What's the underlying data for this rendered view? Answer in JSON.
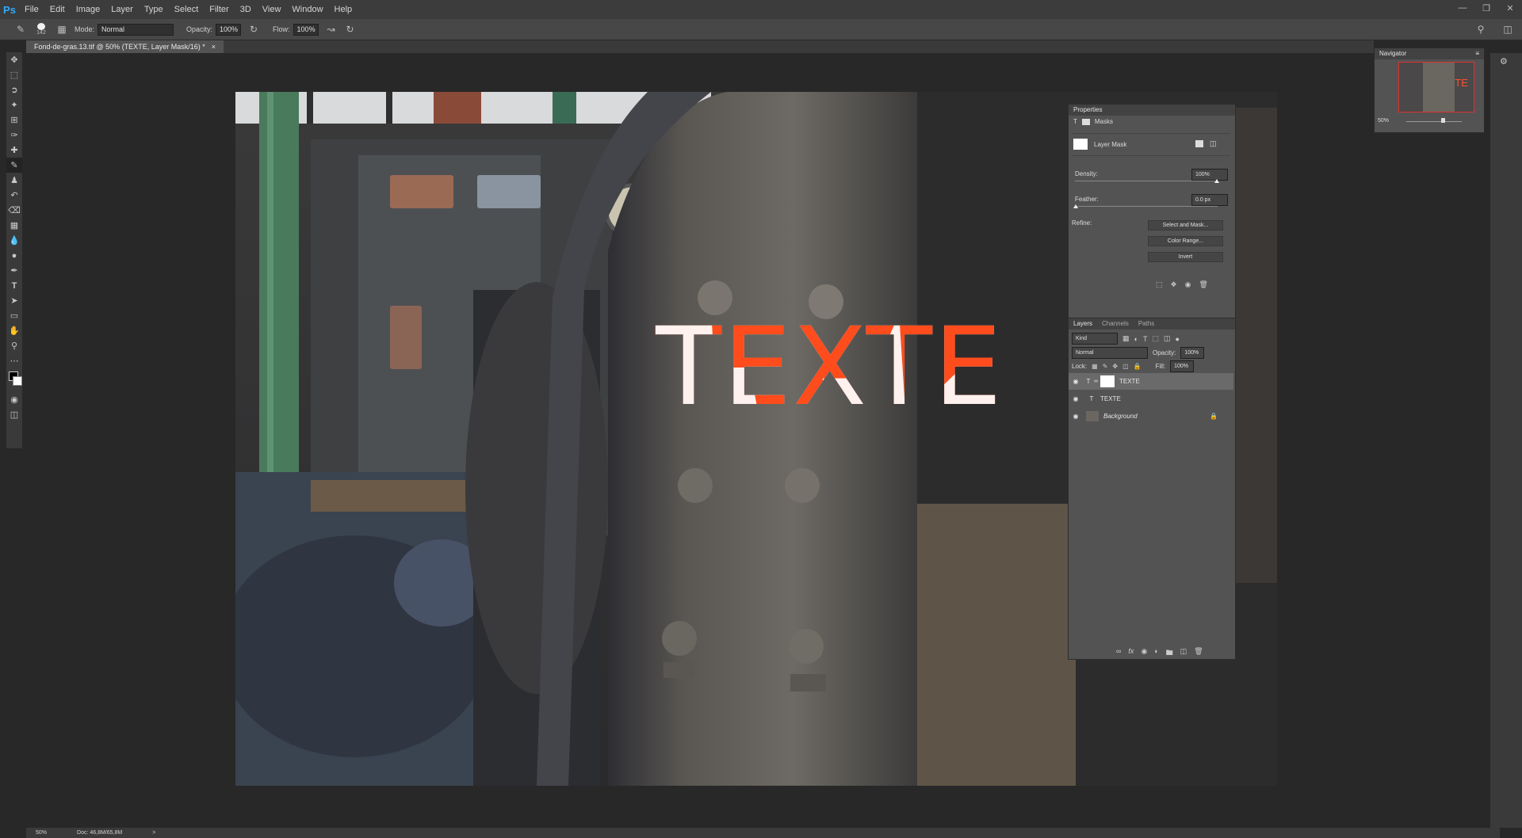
{
  "app": {
    "logo": "Ps"
  },
  "menu": [
    "File",
    "Edit",
    "Image",
    "Layer",
    "Type",
    "Select",
    "Filter",
    "3D",
    "View",
    "Window",
    "Help"
  ],
  "window_controls": [
    "minimize",
    "restore",
    "close"
  ],
  "options_bar": {
    "brush_size": "142",
    "mode_label": "Mode:",
    "mode_value": "Normal",
    "opacity_label": "Opacity:",
    "opacity_value": "100%",
    "flow_label": "Flow:",
    "flow_value": "100%"
  },
  "document": {
    "tab_title": "Fond-de-gras.13.tif @ 50% (TEXTE, Layer Mask/16) *",
    "close": "×"
  },
  "canvas_text": "TEXTE",
  "navigator": {
    "title": "Navigator",
    "zoom": "50%",
    "preview_text": "TEXTE"
  },
  "properties": {
    "title": "Properties",
    "section": "Masks",
    "mask_type": "Layer Mask",
    "density_label": "Density:",
    "density_value": "100%",
    "feather_label": "Feather:",
    "feather_value": "0.0 px",
    "refine_label": "Refine:",
    "buttons": [
      "Select and Mask...",
      "Color Range...",
      "Invert"
    ]
  },
  "layers_panel": {
    "tabs": [
      "Layers",
      "Channels",
      "Paths"
    ],
    "filter_kind": "Kind",
    "blend_mode": "Normal",
    "opacity_label": "Opacity:",
    "opacity_value": "100%",
    "lock_label": "Lock:",
    "fill_label": "Fill:",
    "fill_value": "100%",
    "layers": [
      {
        "name": "TEXTE",
        "type": "T",
        "selected": true,
        "has_mask": true
      },
      {
        "name": "TEXTE",
        "type": "T",
        "selected": false,
        "has_mask": false
      },
      {
        "name": "Background",
        "type": "image",
        "selected": false,
        "locked": true
      }
    ]
  },
  "status": {
    "zoom": "50%",
    "doc": "Doc: 46,8M/65,8M",
    "arrow": ">"
  },
  "colors": {
    "text_orange": "#ff4c1c",
    "accent_blue": "#31a8ff",
    "annotation_red": "#e01010"
  }
}
